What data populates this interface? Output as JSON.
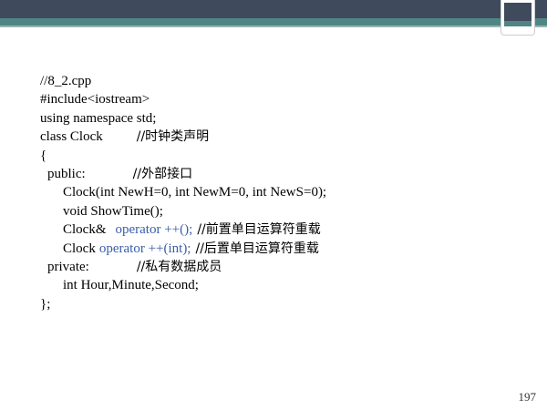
{
  "slide": {
    "code_lines": [
      "//8_2.cpp",
      "#include<iostream>",
      "using namespace std;",
      "class Clock",
      "//时钟类声明",
      "{",
      "public:",
      "//外部接口",
      "Clock(int NewH=0, int NewM=0, int NewS=0);",
      "void ShowTime();",
      "Clock&",
      "operator ++();",
      "//前置单目运算符重载",
      "Clock",
      "operator ++(int);",
      "//后置单目运算符重载",
      "private:",
      "//私有数据成员",
      "int Hour,Minute,Second;",
      "};"
    ],
    "page_number": "197"
  },
  "theme": {
    "header_dark": "#3f4a5c",
    "header_teal": "#4f8585",
    "keyword_color": "#3a5ea8"
  }
}
